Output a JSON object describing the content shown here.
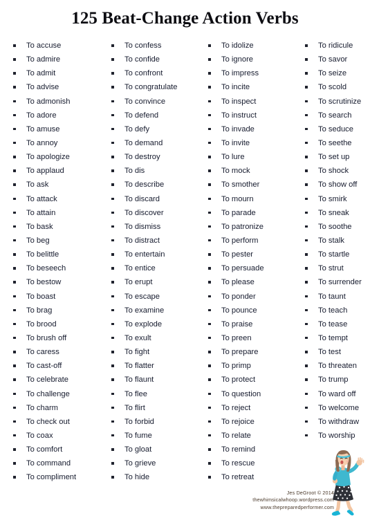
{
  "document": {
    "title": "125 Beat-Change Action Verbs"
  },
  "columns": [
    {
      "index": 1,
      "items": [
        "To accuse",
        "To admire",
        "To admit",
        "To advise",
        "To admonish",
        "To adore",
        "To amuse",
        "To annoy",
        "To apologize",
        "To applaud",
        "To ask",
        "To attack",
        "To attain",
        "To bask",
        "To beg",
        "To belittle",
        "To beseech",
        "To bestow",
        "To boast",
        "To brag",
        "To brood",
        "To brush off",
        "To caress",
        "To cast-off",
        "To celebrate",
        "To challenge",
        "To charm",
        "To check out",
        "To coax",
        "To comfort",
        "To command",
        "To compliment"
      ]
    },
    {
      "index": 2,
      "items": [
        "To confess",
        "To confide",
        "To confront",
        "To congratulate",
        "To convince",
        "To defend",
        "To defy",
        "To demand",
        "To destroy",
        "To dis",
        "To describe",
        "To discard",
        "To discover",
        "To dismiss",
        "To distract",
        "To entertain",
        "To entice",
        "To erupt",
        "To escape",
        "To examine",
        "To explode",
        "To exult",
        "To fight",
        "To flatter",
        "To flaunt",
        "To flee",
        "To flirt",
        "To forbid",
        "To fume",
        "To gloat",
        "To grieve",
        "To hide"
      ]
    },
    {
      "index": 3,
      "items": [
        "To idolize",
        "To ignore",
        "To impress",
        "To incite",
        "To inspect",
        "To instruct",
        "To invade",
        "To invite",
        "To lure",
        "To mock",
        "To smother",
        "To mourn",
        "To parade",
        "To patronize",
        "To perform",
        "To pester",
        "To persuade",
        "To please",
        "To ponder",
        "To pounce",
        "To praise",
        "To preen",
        "To prepare",
        "To primp",
        "To protect",
        "To question",
        "To reject",
        "To rejoice",
        "To relate",
        "To remind",
        "To rescue",
        "To retreat"
      ]
    },
    {
      "index": 4,
      "items": [
        "To ridicule",
        "To savor",
        "To seize",
        "To scold",
        "To scrutinize",
        "To search",
        "To seduce",
        "To seethe",
        "To set up",
        "To shock",
        "To show off",
        "To smirk",
        "To sneak",
        "To soothe",
        "To stalk",
        "To startle",
        "To strut",
        "To surrender",
        "To taunt",
        "To teach",
        "To tease",
        "To tempt",
        "To test",
        "To threaten",
        "To trump",
        "To ward off",
        "To welcome",
        "To withdraw",
        "To worship"
      ]
    }
  ],
  "credits": {
    "line1": "Jes DeGroot © 2014",
    "line2": "thewhimsicalwhoop.wordpress.com",
    "line3": "www.thepreparedperformer.com"
  },
  "illustration": {
    "name": "cartoon-girl-singing-into-microphone",
    "colors": {
      "skin": "#f4c9a8",
      "hair": "#8d6a52",
      "top": "#3fb8cf",
      "headband": "#4fc3d9",
      "skirt": "#2f3138",
      "shoes": "#19b4d6",
      "microphone": "#35aecb"
    }
  }
}
